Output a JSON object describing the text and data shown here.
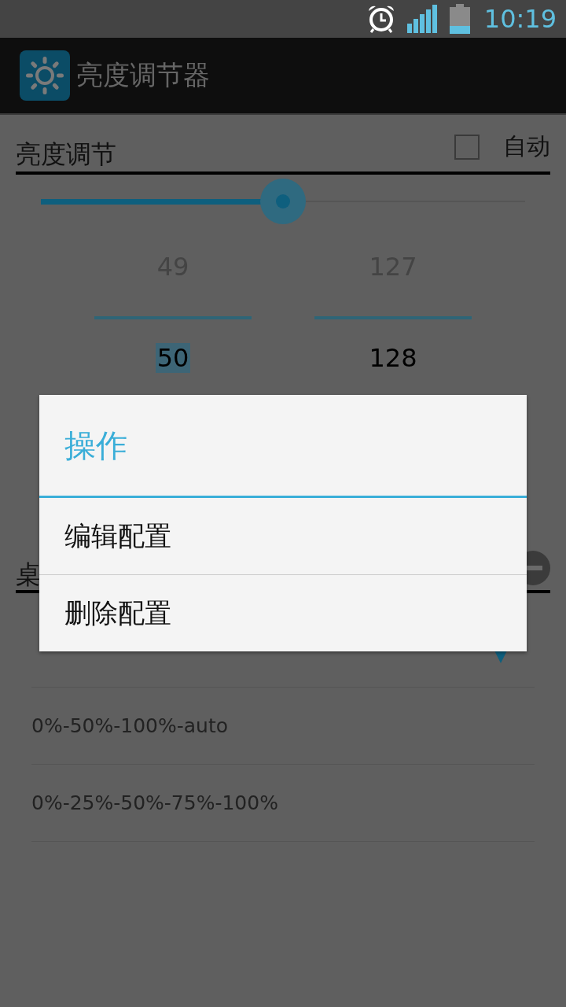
{
  "status_bar": {
    "time": "10:19"
  },
  "action_bar": {
    "title": "亮度调节器"
  },
  "brightness": {
    "title": "亮度调节",
    "auto": {
      "label": "自动",
      "checked": false
    },
    "slider": {
      "level": 0.5
    }
  },
  "pickers": [
    {
      "previous": "49",
      "current": "50",
      "current_selected": true
    },
    {
      "previous": "127",
      "current": "128",
      "current_selected": false
    }
  ],
  "profiles": {
    "title": "桌",
    "rows": [
      {
        "selected": true
      },
      {
        "label": "0%-50%-100%-auto",
        "selected": false
      },
      {
        "label": "0%-25%-50%-75%-100%",
        "selected": false
      }
    ]
  },
  "dialog": {
    "title": "操作",
    "items": [
      "编辑配置",
      "删除配置"
    ]
  }
}
